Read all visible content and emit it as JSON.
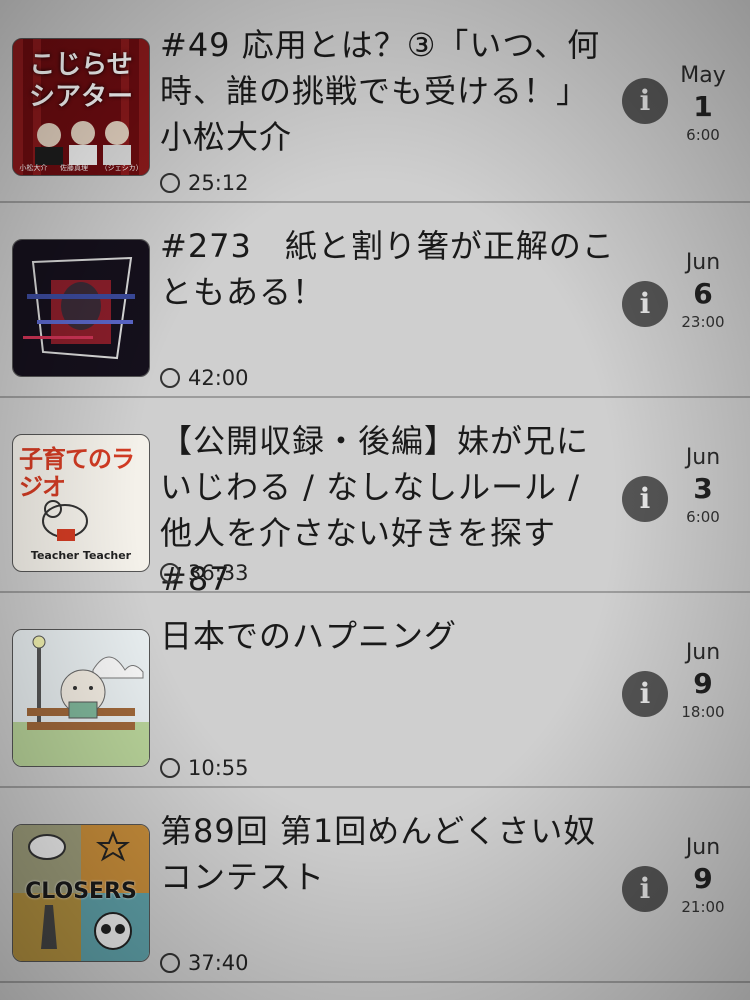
{
  "episodes": [
    {
      "title": "#49 応用とは？③「いつ、何時、誰の挑戦でも受ける！」小松大介",
      "duration": "25:12",
      "month": "May",
      "day": "1",
      "time": "6:00",
      "artwork": {
        "name": "kojirase-theater-artwork",
        "title_line1": "こじらせ",
        "title_line2": "シアター",
        "people": [
          "小松大介",
          "佐藤真理",
          "（ジェシカ）"
        ]
      }
    },
    {
      "title": "#273　紙と割り箸が正解のこともある！",
      "duration": "42:00",
      "month": "Jun",
      "day": "6",
      "time": "23:00",
      "artwork": {
        "name": "dark-glitch-podcast-artwork"
      }
    },
    {
      "title": "【公開収録・後編】妹が兄にいじわる / なしなしルール / 他人を介さない好きを探す #87",
      "duration": "36:33",
      "month": "Jun",
      "day": "3",
      "time": "6:00",
      "artwork": {
        "name": "kosodate-radio-artwork",
        "title_line1": "子育てのラジオ",
        "footer": "Teacher Teacher"
      }
    },
    {
      "title": "日本でのハプニング",
      "duration": "10:55",
      "month": "Jun",
      "day": "9",
      "time": "18:00",
      "artwork": {
        "name": "cat-reading-bench-artwork"
      }
    },
    {
      "title": "第89回 第1回めんどくさい奴コンテスト",
      "duration": "37:40",
      "month": "Jun",
      "day": "9",
      "time": "21:00",
      "artwork": {
        "name": "closers-artwork",
        "title_line1": "CLOSERS"
      }
    }
  ],
  "info_glyph": "i",
  "colors": {
    "background": "#cfcfcf",
    "divider": "#9c9c9c",
    "info_button": "#555555"
  }
}
